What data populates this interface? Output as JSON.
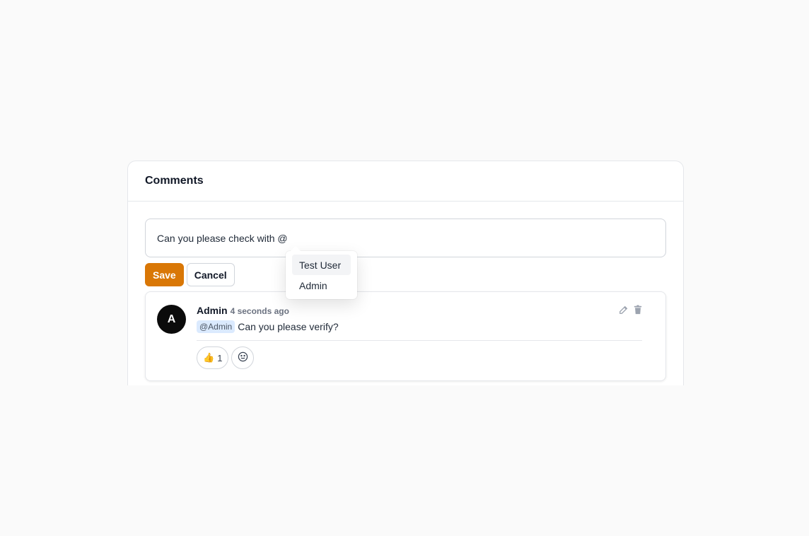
{
  "section": {
    "title": "Comments"
  },
  "editor": {
    "value": "Can you please check with @"
  },
  "actions": {
    "save_label": "Save",
    "cancel_label": "Cancel"
  },
  "mention_menu": {
    "items": [
      "Test User",
      "Admin"
    ],
    "highlighted": "Test User"
  },
  "comment": {
    "avatar_initial": "A",
    "author": "Admin",
    "time": "4 seconds ago",
    "mention": "@Admin",
    "text": "Can you please verify?",
    "reactions": [
      {
        "emoji": "👍",
        "count": "1"
      }
    ]
  },
  "colors": {
    "accent": "#d97706",
    "mention_bg": "#dbeafe",
    "avatar_bg": "#0b0b0b"
  },
  "icons": [
    "edit-icon",
    "trash-icon",
    "smiley-icon"
  ]
}
